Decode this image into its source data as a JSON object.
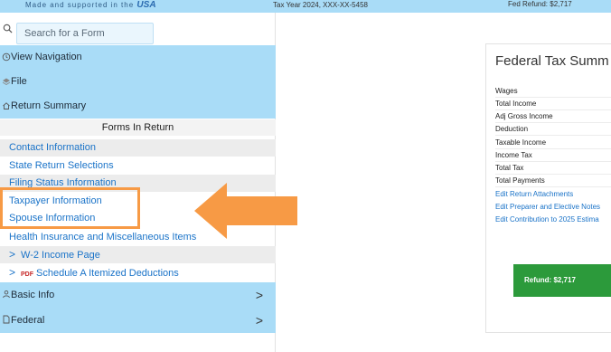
{
  "header": {
    "brand_subtitle": "Made and supported in the",
    "brand_usa": "USA",
    "tax_year": "Tax Year 2024, XXX-XX-5458",
    "fed_refund": "Fed Refund: $2,717"
  },
  "search": {
    "placeholder": "Search for a Form"
  },
  "sidebar": {
    "view_navigation": "View Navigation",
    "file": "File",
    "return_summary": "Return Summary",
    "forms_in_return": "Forms In Return",
    "forms": [
      "Contact Information",
      "State Return Selections",
      "Filing Status Information",
      "Taxpayer Information",
      "Spouse Information",
      "Health Insurance and Miscellaneous Items",
      "W-2 Income Page",
      "Schedule A Itemized Deductions"
    ],
    "pdf_badge": "PDF",
    "basic_info": "Basic Info",
    "federal": "Federal"
  },
  "summary": {
    "title": "Federal Tax Summ",
    "rows": [
      "Wages",
      "Total Income",
      "Adj Gross Income",
      "Deduction",
      "Taxable Income",
      "Income Tax",
      "Total Tax",
      "Total Payments"
    ],
    "links": [
      "Edit Return Attachments",
      "Edit Preparer and Elective Notes",
      "Edit Contribution to 2025 Estima"
    ],
    "refund_button": "Refund: $2,717"
  },
  "colors": {
    "nav_bg": "#a9dcf7",
    "link": "#1a73c8",
    "highlight": "#f79a45",
    "refund": "#2c9a3b"
  }
}
